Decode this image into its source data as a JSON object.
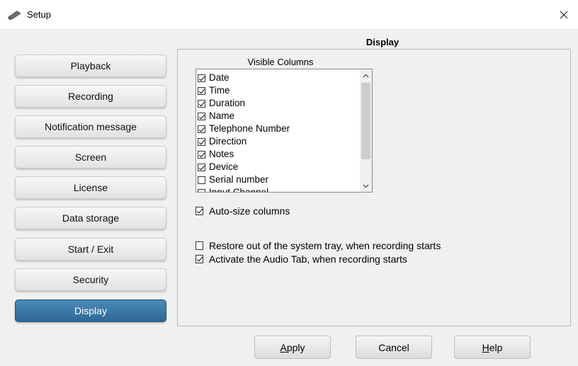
{
  "window": {
    "title": "Setup",
    "icon": "pen-icon"
  },
  "section_title": "Display",
  "nav": [
    {
      "label": "Playback",
      "active": false
    },
    {
      "label": "Recording",
      "active": false
    },
    {
      "label": "Notification message",
      "active": false
    },
    {
      "label": "Screen",
      "active": false
    },
    {
      "label": "License",
      "active": false
    },
    {
      "label": "Data storage",
      "active": false
    },
    {
      "label": "Start / Exit",
      "active": false
    },
    {
      "label": "Security",
      "active": false
    },
    {
      "label": "Display",
      "active": true
    }
  ],
  "visible_columns": {
    "label": "Visible Columns",
    "items": [
      {
        "label": "Date",
        "checked": true
      },
      {
        "label": "Time",
        "checked": true
      },
      {
        "label": "Duration",
        "checked": true
      },
      {
        "label": "Name",
        "checked": true
      },
      {
        "label": "Telephone Number",
        "checked": true
      },
      {
        "label": "Direction",
        "checked": true
      },
      {
        "label": "Notes",
        "checked": true
      },
      {
        "label": "Device",
        "checked": true
      },
      {
        "label": "Serial number",
        "checked": false
      },
      {
        "label": "Input Channel",
        "checked": false
      }
    ]
  },
  "options": {
    "auto_size": {
      "label": "Auto-size columns",
      "checked": true
    },
    "restore_tray": {
      "label": "Restore out of the system tray, when recording starts",
      "checked": false
    },
    "activate_audio": {
      "label": "Activate the Audio Tab, when recording starts",
      "checked": true
    }
  },
  "buttons": {
    "apply": {
      "mnemonic": "A",
      "rest": "pply"
    },
    "cancel": {
      "label": "Cancel"
    },
    "help": {
      "mnemonic": "H",
      "rest": "elp"
    }
  },
  "colors": {
    "active_nav": "#3a79a8",
    "window_bg": "#f0f0f0"
  }
}
